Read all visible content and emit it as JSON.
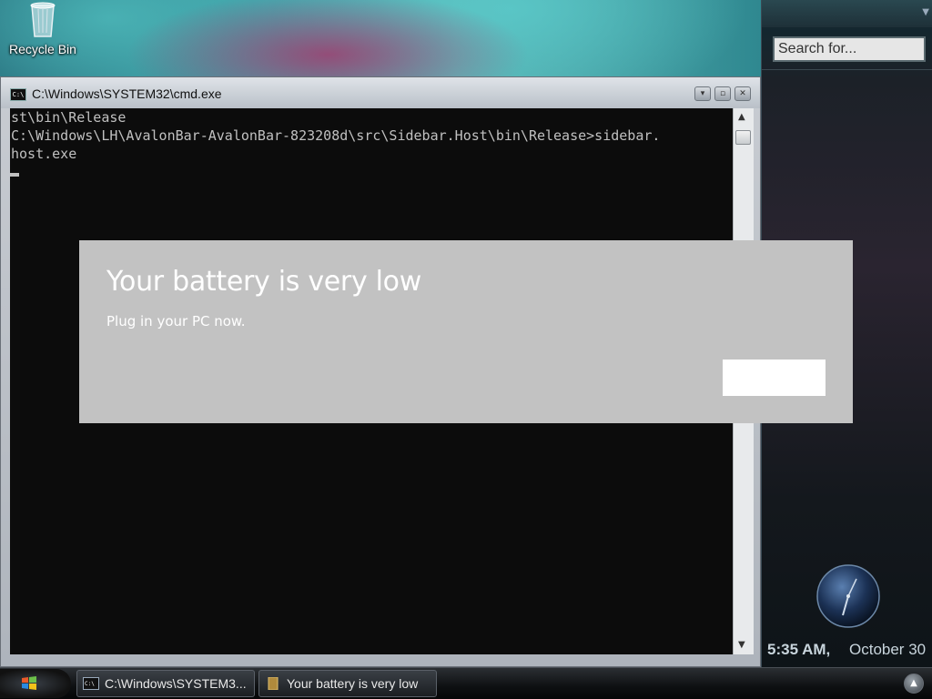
{
  "desktop": {
    "recycle_bin_label": "Recycle Bin"
  },
  "sidebar": {
    "search_placeholder": "Search for...",
    "time": "5:35 AM,",
    "date": "October 30"
  },
  "cmd_window": {
    "title": "C:\\Windows\\SYSTEM32\\cmd.exe",
    "console_lines": [
      "st\\bin\\Release",
      "",
      "C:\\Windows\\LH\\AvalonBar-AvalonBar-823208d\\src\\Sidebar.Host\\bin\\Release>sidebar.",
      "host.exe"
    ]
  },
  "toast": {
    "title": "Your battery is very low",
    "message": "Plug in your PC now.",
    "button_label": ""
  },
  "taskbar": {
    "items": [
      {
        "label": "C:\\Windows\\SYSTEM3..."
      },
      {
        "label": "Your battery is very low"
      }
    ]
  },
  "colors": {
    "toast_bg": "#c2c2c2",
    "console_bg": "#0c0c0c",
    "console_fg": "#c0c0c0"
  }
}
